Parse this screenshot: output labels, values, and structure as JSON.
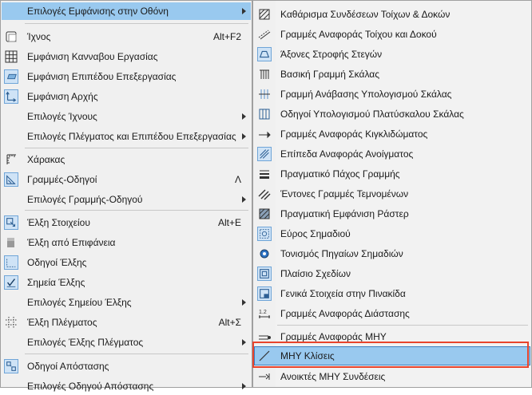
{
  "left_menu": {
    "items": [
      {
        "label": "Επιλογές Εμφάνισης στην Οθόνη",
        "shortcut": "",
        "submenu": true
      },
      {
        "label": "Ίχνος",
        "shortcut": "Alt+F2",
        "submenu": false
      },
      {
        "label": "Εμφάνιση Κανναβου Εργασίας",
        "shortcut": "",
        "submenu": false
      },
      {
        "label": "Εμφάνιση Επιπέδου Επεξεργασίας",
        "shortcut": "",
        "submenu": false
      },
      {
        "label": "Εμφάνιση Αρχής",
        "shortcut": "",
        "submenu": false
      },
      {
        "label": "Επιλογές Ίχνους",
        "shortcut": "",
        "submenu": true
      },
      {
        "label": "Επιλογές Πλέγματος και Επιπέδου Επεξεργασίας",
        "shortcut": "",
        "submenu": true
      },
      {
        "label": "Χάρακας",
        "shortcut": "",
        "submenu": false
      },
      {
        "label": "Γραμμές-Οδηγοί",
        "shortcut": "Λ",
        "submenu": false
      },
      {
        "label": "Επιλογές Γραμμής-Οδηγού",
        "shortcut": "",
        "submenu": true
      },
      {
        "label": "Έλξη Στοιχείου",
        "shortcut": "Alt+E",
        "submenu": false
      },
      {
        "label": "Έλξη από Επιφάνεια",
        "shortcut": "",
        "submenu": false
      },
      {
        "label": "Οδηγοί Έλξης",
        "shortcut": "",
        "submenu": false
      },
      {
        "label": "Σημεία Έλξης",
        "shortcut": "",
        "submenu": false
      },
      {
        "label": "Επιλογές Σημείου Έλξης",
        "shortcut": "",
        "submenu": true
      },
      {
        "label": "Έλξη Πλέγματος",
        "shortcut": "Alt+Σ",
        "submenu": false
      },
      {
        "label": "Επιλογές Έλξης Πλέγματος",
        "shortcut": "",
        "submenu": true
      },
      {
        "label": "Οδηγοί Απόστασης",
        "shortcut": "",
        "submenu": false
      },
      {
        "label": "Επιλογές Οδηγού Απόστασης",
        "shortcut": "",
        "submenu": true
      }
    ]
  },
  "right_menu": {
    "items": [
      {
        "label": "Καθάρισμα Συνδέσεων Τοίχων & Δοκών"
      },
      {
        "label": "Γραμμές Αναφοράς Τοίχου και Δοκού"
      },
      {
        "label": "Άξονες Στροφής Στεγών"
      },
      {
        "label": "Βασική Γραμμή Σκάλας"
      },
      {
        "label": "Γραμμή Ανάβασης Υπολογισμού Σκάλας"
      },
      {
        "label": "Οδηγοί Υπολογισμού Πλατύσκαλου Σκάλας"
      },
      {
        "label": "Γραμμές Αναφοράς Κιγκλιδώματος"
      },
      {
        "label": "Επίπεδα Αναφοράς Ανοίγματος"
      },
      {
        "label": "Πραγματικό Πάχος Γραμμής"
      },
      {
        "label": "Έντονες Γραμμές Τεμνομένων"
      },
      {
        "label": "Πραγματική Εμφάνιση Ράστερ"
      },
      {
        "label": "Εύρος Σημαδιού"
      },
      {
        "label": "Τονισμός Πηγαίων Σημαδιών"
      },
      {
        "label": "Πλαίσιο Σχεδίων"
      },
      {
        "label": "Γενικά Στοιχεία στην Πινακίδα"
      },
      {
        "label": "Γραμμές Αναφοράς Διάστασης"
      },
      {
        "label": "Γραμμές Αναφοράς ΜΗΥ"
      },
      {
        "label": "ΜΗΥ Κλίσεις"
      },
      {
        "label": "Ανοικτές ΜΗΥ Συνδέσεις"
      }
    ],
    "selected_index": 17
  },
  "colors": {
    "menu_bg": "#f0f0f0",
    "highlight": "#99c9ef",
    "callout": "#e8442c"
  }
}
